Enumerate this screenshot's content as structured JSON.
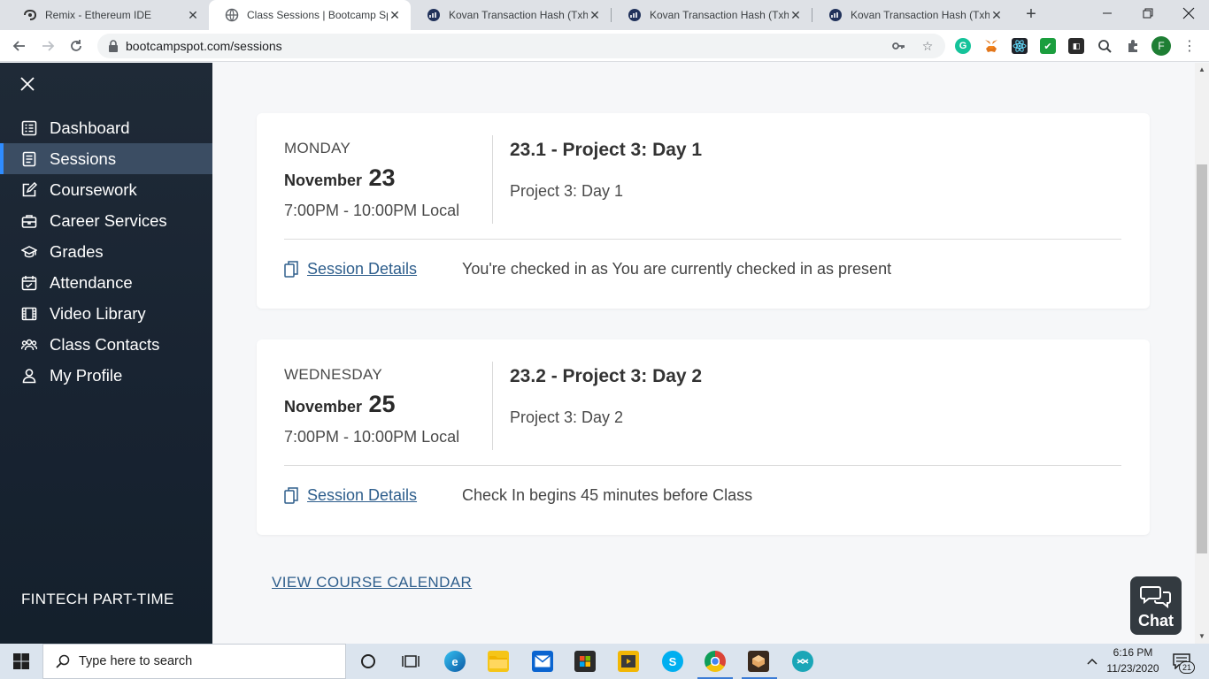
{
  "browser": {
    "tabs": [
      {
        "title": "Remix - Ethereum IDE",
        "icon": "remix-icon"
      },
      {
        "title": "Class Sessions | Bootcamp Spo",
        "icon": "globe-icon"
      },
      {
        "title": "Kovan Transaction Hash (Txhas",
        "icon": "etherscan-icon"
      },
      {
        "title": "Kovan Transaction Hash (Txhas",
        "icon": "etherscan-icon"
      },
      {
        "title": "Kovan Transaction Hash (Txhas",
        "icon": "etherscan-icon"
      }
    ],
    "active_tab_index": 1,
    "new_tab": "+",
    "url": "bootcampspot.com/sessions",
    "profile_initial": "F"
  },
  "sidebar": {
    "items": [
      {
        "label": "Dashboard",
        "icon": "dashboard-icon"
      },
      {
        "label": "Sessions",
        "icon": "sessions-icon"
      },
      {
        "label": "Coursework",
        "icon": "edit-icon"
      },
      {
        "label": "Career Services",
        "icon": "briefcase-icon"
      },
      {
        "label": "Grades",
        "icon": "graduation-cap-icon"
      },
      {
        "label": "Attendance",
        "icon": "calendar-check-icon"
      },
      {
        "label": "Video Library",
        "icon": "film-icon"
      },
      {
        "label": "Class Contacts",
        "icon": "users-icon"
      },
      {
        "label": "My Profile",
        "icon": "user-icon"
      }
    ],
    "active_index": 1,
    "cohort": "FINTECH PART-TIME"
  },
  "sessions": [
    {
      "weekday": "MONDAY",
      "month": "November",
      "day": "23",
      "time": "7:00PM - 10:00PM Local",
      "title": "23.1 - Project 3: Day 1",
      "subtitle": "Project 3: Day 1",
      "details_label": "Session Details",
      "status": "You're checked in as You are currently checked in as present"
    },
    {
      "weekday": "WEDNESDAY",
      "month": "November",
      "day": "25",
      "time": "7:00PM - 10:00PM Local",
      "title": "23.2 - Project 3: Day 2",
      "subtitle": "Project 3: Day 2",
      "details_label": "Session Details",
      "status": "Check In begins 45 minutes before Class"
    }
  ],
  "calendar_link": "VIEW COURSE CALENDAR",
  "chat_label": "Chat",
  "taskbar": {
    "search_placeholder": "Type here to search",
    "time": "6:16 PM",
    "date": "11/23/2020",
    "notification_count": "21"
  },
  "colors": {
    "sidebar_bg": "#1f2a37",
    "sidebar_active": "#3b4d63",
    "link": "#2e5e8c",
    "chat_bg": "#333a40"
  }
}
